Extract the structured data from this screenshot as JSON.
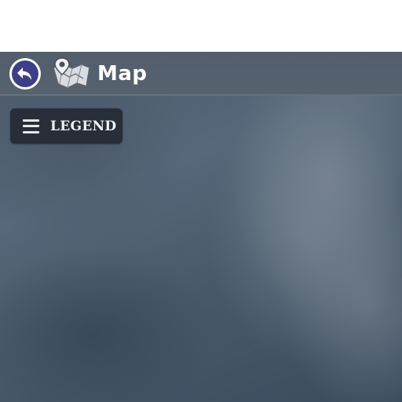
{
  "header": {
    "title": "Map",
    "back_icon": "back-arrow-icon",
    "map_icon": "folded-map-pin-icon"
  },
  "legend": {
    "label": "LEGEND",
    "icon": "hamburger-menu-icon"
  },
  "colors": {
    "back_button_fill": "#3c3f86",
    "header_bar": "#545f6b",
    "legend_bg": "#272e38",
    "map_fog": "#56687a"
  }
}
